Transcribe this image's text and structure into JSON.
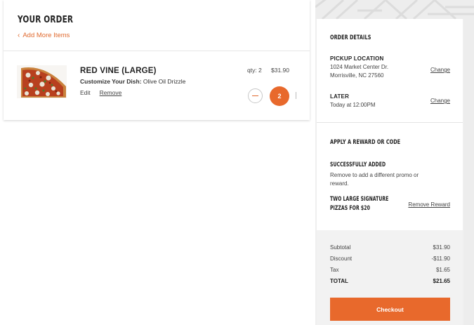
{
  "order": {
    "title": "YOUR ORDER",
    "add_more_label": "Add More Items",
    "item": {
      "name": "RED VINE (LARGE)",
      "customize_label": "Customize Your Dish:",
      "customize_value": "Olive Oil Drizzle",
      "edit_label": "Edit",
      "remove_label": "Remove",
      "qty_text": "qty: 2",
      "price": "$31.90",
      "quantity": "2"
    }
  },
  "details": {
    "heading": "ORDER DETAILS",
    "pickup_label": "PICKUP LOCATION",
    "address_line1": "1024 Market Center Dr.",
    "address_line2": "Morrisville, NC 27560",
    "change_location_label": "Change",
    "time_label": "LATER",
    "time_value": "Today at 12:00PM",
    "change_time_label": "Change"
  },
  "reward": {
    "heading": "APPLY A REWARD OR CODE",
    "status": "SUCCESSFULLY ADDED",
    "note_line1": "Remove to add a different promo or",
    "note_line2": "reward.",
    "reward_name_line1": "TWO LARGE SIGNATURE",
    "reward_name_line2": "PIZZAS FOR $20",
    "remove_label": "Remove Reward"
  },
  "totals": {
    "rows": [
      {
        "label": "Subtotal",
        "value": "$31.90"
      },
      {
        "label": "Discount",
        "value": "-$11.90"
      },
      {
        "label": "Tax",
        "value": "$1.65"
      },
      {
        "label": "TOTAL",
        "value": "$21.65"
      }
    ],
    "checkout_label": "Checkout"
  },
  "icons": {
    "back": "chevron-left-icon",
    "minus": "minus-icon",
    "pizza": "pizza-image"
  },
  "colors": {
    "accent": "#e8692c",
    "link": "#e06a2f"
  }
}
